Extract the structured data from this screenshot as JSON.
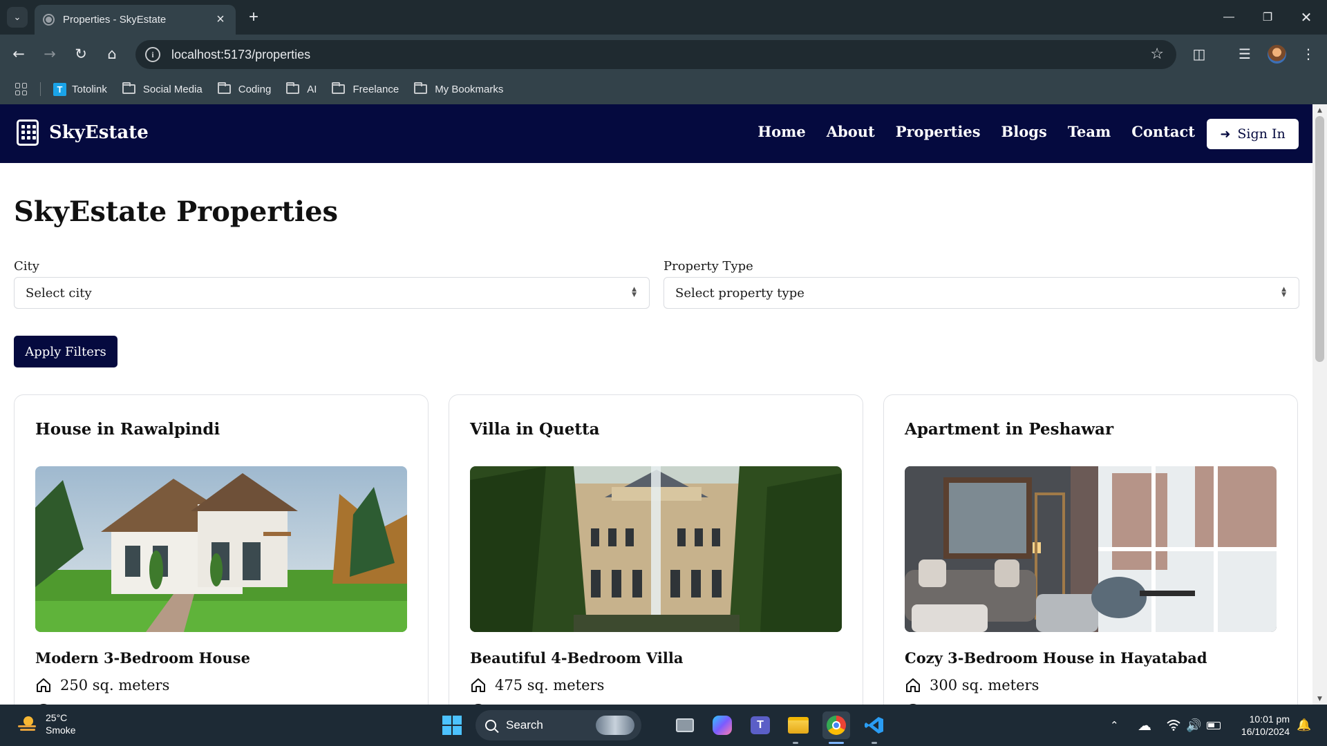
{
  "browser": {
    "tab_title": "Properties - SkyEstate",
    "url": "localhost:5173/properties",
    "bookmarks": [
      "Totolink",
      "Social Media",
      "Coding",
      "AI",
      "Freelance",
      "My Bookmarks"
    ]
  },
  "site": {
    "brand": "SkyEstate",
    "nav": [
      "Home",
      "About",
      "Properties",
      "Blogs",
      "Team",
      "Contact"
    ],
    "sign_in": "Sign In"
  },
  "page": {
    "title": "SkyEstate Properties",
    "filters": {
      "city_label": "City",
      "city_value": "Select city",
      "type_label": "Property Type",
      "type_value": "Select property type",
      "apply": "Apply Filters"
    },
    "cards": [
      {
        "title": "House in Rawalpindi",
        "name": "Modern 3-Bedroom House",
        "area": "250 sq. meters"
      },
      {
        "title": "Villa in Quetta",
        "name": "Beautiful 4-Bedroom Villa",
        "area": "475 sq. meters"
      },
      {
        "title": "Apartment in Peshawar",
        "name": "Cozy 3-Bedroom House in Hayatabad",
        "area": "300 sq. meters"
      }
    ]
  },
  "taskbar": {
    "temp": "25°C",
    "weather": "Smoke",
    "search": "Search",
    "time": "10:01 pm",
    "date": "16/10/2024"
  },
  "colors": {
    "navy": "#050a3f",
    "chrome_dark": "#1f2a30",
    "chrome_toolbar": "#33424a",
    "taskbar": "#1d2a35"
  }
}
